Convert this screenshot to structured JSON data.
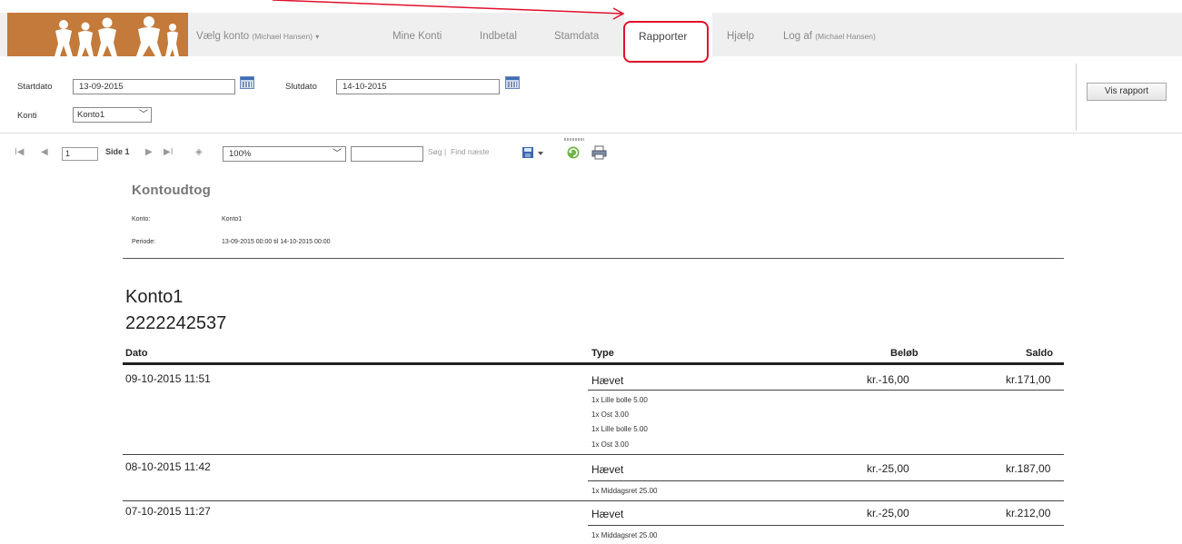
{
  "nav": {
    "items": [
      {
        "label": "Vælg konto",
        "sub": "(Michael Hansen)",
        "caret": "▾"
      },
      {
        "label": "Mine Konti"
      },
      {
        "label": "Indbetal"
      },
      {
        "label": "Stamdata"
      },
      {
        "label": "Rapporter",
        "active": true
      },
      {
        "label": "Hjælp"
      },
      {
        "label": "Log af",
        "sub": "(Michael Hansen)"
      }
    ],
    "highlight_color": "#e0102a"
  },
  "params": {
    "startdato_label": "Startdato",
    "startdato_value": "13-09-2015",
    "slutdato_label": "Slutdato",
    "slutdato_value": "14-10-2015",
    "konti_label": "Konti",
    "konti_value": "Konto1",
    "view_button": "Vis rapport"
  },
  "toolbar": {
    "first": "I◀",
    "prev": "◀",
    "page_value": "1",
    "page_text": "Side 1",
    "next": "▶",
    "last": "▶I",
    "back": "◈",
    "zoom": "100%",
    "search_link": "Søg",
    "separator": "|",
    "find_next": "Find næste"
  },
  "report": {
    "title": "Kontoudtog",
    "konto_label": "Konto:",
    "konto_value": "Konto1",
    "periode_label": "Periode:",
    "periode_value": "13-09-2015 00:00 til 14-10-2015 00:00",
    "account_name": "Konto1",
    "account_number": "2222242537",
    "columns": {
      "dato": "Dato",
      "type": "Type",
      "beloeb": "Beløb",
      "saldo": "Saldo"
    },
    "rows": [
      {
        "dato": "09-10-2015 11:51",
        "type": "Hævet",
        "beloeb": "kr.-16,00",
        "saldo": "kr.171,00",
        "items": [
          "1x Lille bolle 5.00",
          "1x Ost 3.00",
          "1x Lille bolle 5.00",
          "1x Ost 3.00"
        ]
      },
      {
        "dato": "08-10-2015 11:42",
        "type": "Hævet",
        "beloeb": "kr.-25,00",
        "saldo": "kr.187,00",
        "items": [
          "1x Middagsret 25.00"
        ]
      },
      {
        "dato": "07-10-2015 11:27",
        "type": "Hævet",
        "beloeb": "kr.-25,00",
        "saldo": "kr.212,00",
        "items": [
          "1x Middagsret 25.00"
        ]
      }
    ]
  }
}
